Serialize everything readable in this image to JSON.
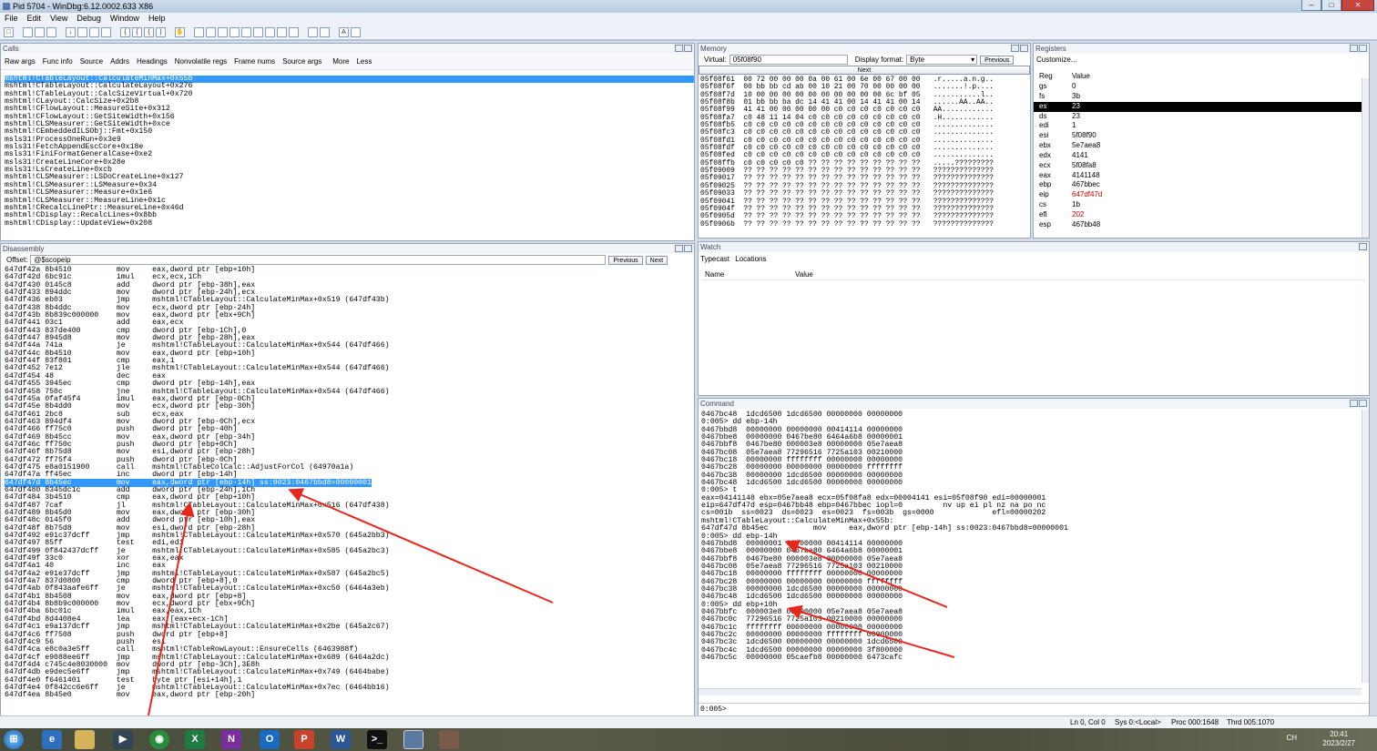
{
  "title": "Pid 5704 - WinDbg:6.12.0002.633 X86",
  "menu": [
    "File",
    "Edit",
    "View",
    "Debug",
    "Window",
    "Help"
  ],
  "calls": {
    "header": "Calls",
    "toolbar": [
      "Raw args",
      "Func info",
      "Source",
      "Addrs",
      "Headings",
      "Nonvolatile regs",
      "Frame nums",
      "Source args",
      "More",
      "Less"
    ],
    "lines": [
      "mshtml!CTableLayout::CalculateMinMax+0x55b",
      "mshtml!CTableLayout::CalculateLayout+0x276",
      "mshtml!CTableLayout::CalcSizeVirtual+0x720",
      "mshtml!CLayout::CalcSize+0x2b8",
      "mshtml!CFlowLayout::MeasureSite+0x312",
      "mshtml!CFlowLayout::GetSiteWidth+0x156",
      "mshtml!CLSMeasurer::GetSiteWidth+0xce",
      "mshtml!CEmbeddedILSObj::Fmt+0x150",
      "msls31!ProcessOneRun+0x3e9",
      "msls31!FetchAppendEscCore+0x18e",
      "msls31!FiniFormatGeneralCase+0xe2",
      "msls31!CreateLineCore+0x28e",
      "msls31!LsCreateLine+0xcb",
      "mshtml!CLSMeasurer::LSDoCreateLine+0x127",
      "mshtml!CLSMeasurer::LSMeasure+0x34",
      "mshtml!CLSMeasurer::Measure+0x1e6",
      "mshtml!CLSMeasurer::MeasureLine+0x1c",
      "mshtml!CRecalcLinePtr::MeasureLine+0x46d",
      "mshtml!CDisplay::RecalcLines+0x8bb",
      "mshtml!CDisplay::UpdateView+0x208"
    ]
  },
  "memory": {
    "header": "Memory",
    "virtual_label": "Virtual:",
    "virtual_value": "05f08f90",
    "display_label": "Display format:",
    "display_value": "Byte",
    "previous": "Previous",
    "next": "Next",
    "lines": [
      "05f08f61  00 72 00 00 00 0a 00 61 00 6e 00 67 00 00   .r.....a.n.g..",
      "05f08f6f  00 bb bb cd ab 00 10 21 00 70 00 00 00 00   .......!.p....",
      "05f08f7d  10 00 00 00 00 00 00 00 00 00 00 6c bf 05   ...........l..",
      "05f08f8b  01 bb bb ba dc 14 41 41 00 14 41 41 00 14   ......AA..AA..",
      "05f08f99  41 41 00 00 00 00 00 c0 c0 c0 c0 c0 c0 c0   AA............",
      "05f08fa7  c0 48 11 14 04 c0 c0 c0 c0 c0 c0 c0 c0 c0   .H............",
      "05f08fb5  c0 c0 c0 c0 c0 c0 c0 c0 c0 c0 c0 c0 c0 c0   ..............",
      "05f08fc3  c0 c0 c0 c0 c0 c0 c0 c0 c0 c0 c0 c0 c0 c0   ..............",
      "05f08fd1  c0 c0 c0 c0 c0 c0 c0 c0 c0 c0 c0 c0 c0 c0   ..............",
      "05f08fdf  c0 c0 c0 c0 c0 c0 c0 c0 c0 c0 c0 c0 c0 c0   ..............",
      "05f08fed  c0 c0 c0 c0 c0 c0 c0 c0 c0 c0 c0 c0 c0 c0   ..............",
      "05f08ffb  c0 c0 c0 c0 c0 ?? ?? ?? ?? ?? ?? ?? ?? ??   .....?????????",
      "05f09009  ?? ?? ?? ?? ?? ?? ?? ?? ?? ?? ?? ?? ?? ??   ??????????????",
      "05f09017  ?? ?? ?? ?? ?? ?? ?? ?? ?? ?? ?? ?? ?? ??   ??????????????",
      "05f09025  ?? ?? ?? ?? ?? ?? ?? ?? ?? ?? ?? ?? ?? ??   ??????????????",
      "05f09033  ?? ?? ?? ?? ?? ?? ?? ?? ?? ?? ?? ?? ?? ??   ??????????????",
      "05f09041  ?? ?? ?? ?? ?? ?? ?? ?? ?? ?? ?? ?? ?? ??   ??????????????",
      "05f0904f  ?? ?? ?? ?? ?? ?? ?? ?? ?? ?? ?? ?? ?? ??   ??????????????",
      "05f0905d  ?? ?? ?? ?? ?? ?? ?? ?? ?? ?? ?? ?? ?? ??   ??????????????",
      "05f0906b  ?? ?? ?? ?? ?? ?? ?? ?? ?? ?? ?? ?? ?? ??   ??????????????"
    ]
  },
  "registers": {
    "header": "Registers",
    "customize": "Customize...",
    "col_reg": "Reg",
    "col_value": "Value",
    "rows": [
      [
        "gs",
        "0",
        ""
      ],
      [
        "fs",
        "3b",
        ""
      ],
      [
        "es",
        "23",
        "sel"
      ],
      [
        "ds",
        "23",
        ""
      ],
      [
        "edi",
        "1",
        ""
      ],
      [
        "esi",
        "5f08f90",
        ""
      ],
      [
        "ebx",
        "5e7aea8",
        ""
      ],
      [
        "edx",
        "4141",
        ""
      ],
      [
        "ecx",
        "5f08fa8",
        ""
      ],
      [
        "eax",
        "4141148",
        ""
      ],
      [
        "ebp",
        "467bbec",
        ""
      ],
      [
        "eip",
        "647df47d",
        "red"
      ],
      [
        "cs",
        "1b",
        ""
      ],
      [
        "efl",
        "202",
        "red"
      ],
      [
        "esp",
        "467bb48",
        ""
      ]
    ]
  },
  "disasm": {
    "header": "Disassembly",
    "offset_label": "Offset:",
    "offset_value": "@$scopeip",
    "previous": "Previous",
    "next": "Next",
    "lines": [
      [
        "647df42a",
        "8b4510",
        "mov",
        "eax,dword ptr [ebp+10h]"
      ],
      [
        "647df42d",
        "6bc91c",
        "imul",
        "ecx,ecx,1Ch"
      ],
      [
        "647df430",
        "0145c8",
        "add",
        "dword ptr [ebp-38h],eax"
      ],
      [
        "647df433",
        "894ddc",
        "mov",
        "dword ptr [ebp-24h],ecx"
      ],
      [
        "647df436",
        "eb03",
        "jmp",
        "mshtml!CTableLayout::CalculateMinMax+0x519 (647df43b)"
      ],
      [
        "647df438",
        "8b4ddc",
        "mov",
        "ecx,dword ptr [ebp-24h]"
      ],
      [
        "647df43b",
        "8b839c000000",
        "mov",
        "eax,dword ptr [ebx+9Ch]"
      ],
      [
        "647df441",
        "03c1",
        "add",
        "eax,ecx"
      ],
      [
        "647df443",
        "837de400",
        "cmp",
        "dword ptr [ebp-1Ch],0"
      ],
      [
        "647df447",
        "8945d8",
        "mov",
        "dword ptr [ebp-28h],eax"
      ],
      [
        "647df44a",
        "741a",
        "je",
        "mshtml!CTableLayout::CalculateMinMax+0x544 (647df466)"
      ],
      [
        "647df44c",
        "8b4510",
        "mov",
        "eax,dword ptr [ebp+10h]"
      ],
      [
        "647df44f",
        "83f801",
        "cmp",
        "eax,1"
      ],
      [
        "647df452",
        "7e12",
        "jle",
        "mshtml!CTableLayout::CalculateMinMax+0x544 (647df466)"
      ],
      [
        "647df454",
        "48",
        "dec",
        "eax"
      ],
      [
        "647df455",
        "3945ec",
        "cmp",
        "dword ptr [ebp-14h],eax"
      ],
      [
        "647df458",
        "750c",
        "jne",
        "mshtml!CTableLayout::CalculateMinMax+0x544 (647df466)"
      ],
      [
        "647df45a",
        "0faf45f4",
        "imul",
        "eax,dword ptr [ebp-0Ch]"
      ],
      [
        "647df45e",
        "8b4dd0",
        "mov",
        "ecx,dword ptr [ebp-30h]"
      ],
      [
        "647df461",
        "2bc8",
        "sub",
        "ecx,eax"
      ],
      [
        "647df463",
        "894df4",
        "mov",
        "dword ptr [ebp-0Ch],ecx"
      ],
      [
        "647df466",
        "ff75c0",
        "push",
        "dword ptr [ebp-40h]"
      ],
      [
        "647df469",
        "8b45cc",
        "mov",
        "eax,dword ptr [ebp-34h]"
      ],
      [
        "647df46c",
        "ff750c",
        "push",
        "dword ptr [ebp+0Ch]"
      ],
      [
        "647df46f",
        "8b75d8",
        "mov",
        "esi,dword ptr [ebp-28h]"
      ],
      [
        "647df472",
        "ff75f4",
        "push",
        "dword ptr [ebp-0Ch]"
      ],
      [
        "647df475",
        "e8a0151900",
        "call",
        "mshtml!CTableColCalc::AdjustForCol (64970a1a)"
      ],
      [
        "647df47a",
        "ff45ec",
        "inc",
        "dword ptr [ebp-14h]"
      ],
      [
        "647df47d",
        "8b45ec",
        "mov",
        "eax,dword ptr [ebp-14h] ss:0023:0467bbd8=00000001"
      ],
      [
        "647df480",
        "8345dc1c",
        "add",
        "dword ptr [ebp-24h],1Ch"
      ],
      [
        "647df484",
        "3b4510",
        "cmp",
        "eax,dword ptr [ebp+10h]"
      ],
      [
        "647df487",
        "7caf",
        "jl",
        "mshtml!CTableLayout::CalculateMinMax+0x516 (647df438)"
      ],
      [
        "647df489",
        "8b45d0",
        "mov",
        "eax,dword ptr [ebp-30h]"
      ],
      [
        "647df48c",
        "0145f0",
        "add",
        "dword ptr [ebp-10h],eax"
      ],
      [
        "647df48f",
        "8b75d8",
        "mov",
        "esi,dword ptr [ebp-28h]"
      ],
      [
        "647df492",
        "e91c37dcff",
        "jmp",
        "mshtml!CTableLayout::CalculateMinMax+0x570 (645a2bb3)"
      ],
      [
        "647df497",
        "85ff",
        "test",
        "edi,edi"
      ],
      [
        "647df499",
        "0f842437dcff",
        "je",
        "mshtml!CTableLayout::CalculateMinMax+0x585 (645a2bc3)"
      ],
      [
        "647df49f",
        "33c0",
        "xor",
        "eax,eax"
      ],
      [
        "647df4a1",
        "40",
        "inc",
        "eax"
      ],
      [
        "647df4a2",
        "e91e37dcff",
        "jmp",
        "mshtml!CTableLayout::CalculateMinMax+0x587 (645a2bc5)"
      ],
      [
        "647df4a7",
        "837d0800",
        "cmp",
        "dword ptr [ebp+8],0"
      ],
      [
        "647df4ab",
        "0f843aafe6ff",
        "je",
        "mshtml!CTableLayout::CalculateMinMax+0xc50 (6464a3eb)"
      ],
      [
        "647df4b1",
        "8b4508",
        "mov",
        "eax,dword ptr [ebp+8]"
      ],
      [
        "647df4b4",
        "8b8b9c000000",
        "mov",
        "ecx,dword ptr [ebx+9Ch]"
      ],
      [
        "647df4ba",
        "6bc01c",
        "imul",
        "eax,eax,1Ch"
      ],
      [
        "647df4bd",
        "8d4408e4",
        "lea",
        "eax,[eax+ecx-1Ch]"
      ],
      [
        "647df4c1",
        "e9a137dcff",
        "jmp",
        "mshtml!CTableLayout::CalculateMinMax+0x2be (645a2c67)"
      ],
      [
        "647df4c6",
        "ff7508",
        "push",
        "dword ptr [ebp+8]"
      ],
      [
        "647df4c9",
        "56",
        "push",
        "esi"
      ],
      [
        "647df4ca",
        "e8c0a3e5ff",
        "call",
        "mshtml!CTableRowLayout::EnsureCells (6463988f)"
      ],
      [
        "647df4cf",
        "e9088ee6ff",
        "jmp",
        "mshtml!CTableLayout::CalculateMinMax+0x689 (6464a2dc)"
      ],
      [
        "647df4d4",
        "c745c4e8030000",
        "mov",
        "dword ptr [ebp-3Ch],3E8h"
      ],
      [
        "647df4db",
        "e9dec5e6ff",
        "jmp",
        "mshtml!CTableLayout::CalculateMinMax+0x749 (6464babe)"
      ],
      [
        "647df4e0",
        "f6461401",
        "test",
        "byte ptr [esi+14h],1"
      ],
      [
        "647df4e4",
        "0f842cc6e6ff",
        "je",
        "mshtml!CTableLayout::CalculateMinMax+0x7ec (6464bb16)"
      ],
      [
        "647df4ea",
        "8b45e0",
        "mov",
        "eax,dword ptr [ebp-20h]"
      ]
    ]
  },
  "watch": {
    "header": "Watch",
    "toolbar": [
      "Typecast",
      "Locations"
    ],
    "col_name": "Name",
    "col_value": "Value"
  },
  "command": {
    "header": "Command",
    "prompt": "0:005>",
    "lines": [
      "0467bc48  1dcd6500 1dcd6500 00000000 00000000",
      "0:005> dd ebp-14h",
      "0467bbd8  00000000 00000000 00414114 00000000",
      "0467bbe8  00000000 0467be80 6464a6b8 00000001",
      "0467bbf8  0467be80 000003e8 00000000 05e7aea8",
      "0467bc08  05e7aea8 77296516 7725a103 00210000",
      "0467bc18  00000000 ffffffff 00000000 00000000",
      "0467bc28  00000000 00000000 00000000 ffffffff",
      "0467bc38  00000000 1dcd6500 00000000 00000000",
      "0467bc48  1dcd6500 1dcd6500 00000000 00000000",
      "0:005> t",
      "eax=04141148 ebx=05e7aea8 ecx=05f08fa8 edx=00004141 esi=05f08f90 edi=00000001",
      "eip=647df47d esp=0467bb48 ebp=0467bbec iopl=0         nv up ei pl nz na po nc",
      "cs=001b  ss=0023  ds=0023  es=0023  fs=003b  gs=0000             efl=00000202",
      "mshtml!CTableLayout::CalculateMinMax+0x55b:",
      "647df47d 8b45ec          mov     eax,dword ptr [ebp-14h] ss:0023:0467bbd8=00000001",
      "0:005> dd ebp-14h",
      "0467bbd8  00000001 00000000 00414114 00000000",
      "0467bbe8  00000000 0467be80 6464a6b8 00000001",
      "0467bbf8  0467be80 000003e8 00000000 05e7aea8",
      "0467bc08  05e7aea8 77296516 7725a103 00210000",
      "0467bc18  00000000 ffffffff 00000000 00000000",
      "0467bc28  00000000 00000000 00000000 ffffffff",
      "0467bc38  00000000 1dcd6500 00000000 00000000",
      "0467bc48  1dcd6500 1dcd6500 00000000 00000000",
      "0:005> dd ebp+10h",
      "0467bbfc  000003e8 00000000 05e7aea8 05e7aea8",
      "0467bc0c  77296516 7725a103 00210000 00000000",
      "0467bc1c  ffffffff 00000000 00000000 00000000",
      "0467bc2c  00000000 00000000 ffffffff 00000000",
      "0467bc3c  1dcd6500 00000000 00000000 1dcd6500",
      "0467bc4c  1dcd6500 00000000 00000000 3f800000",
      "0467bc5c  00000000 05caefb8 00000000 6473cafc"
    ]
  },
  "status": {
    "pos": "Ln 0, Col 0",
    "sys": "Sys 0:<Local>",
    "proc": "Proc 000:1648",
    "thrd": "Thrd 005:1070"
  },
  "taskbar": {
    "time": "20:41",
    "date": "2023/2/27",
    "lang": "CH"
  },
  "colors": {
    "highlight": "#3399ff",
    "arrow": "#e8281e",
    "red_reg": "#d40000"
  }
}
